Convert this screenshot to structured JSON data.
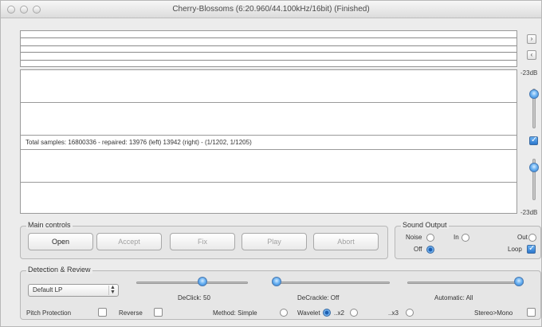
{
  "window": {
    "title": "Cherry-Blossoms (6:20.960/44.100kHz/16bit) (Finished)"
  },
  "side_buttons": {
    "forward": "›",
    "back": "‹"
  },
  "stats_text": "Total samples: 16800336 - repaired: 13976 (left) 13942 (right) - (1/1202, 1/1205)",
  "level": {
    "top_label": "-23dB",
    "bottom_label": "-23dB",
    "link_checked": true
  },
  "main_controls": {
    "title": "Main controls",
    "buttons": [
      "Open",
      "Accept",
      "Fix",
      "Play",
      "Abort"
    ],
    "enabled": [
      true,
      false,
      false,
      false,
      false
    ]
  },
  "sound_output": {
    "title": "Sound Output",
    "noise": "Noise",
    "in": "In",
    "out": "Out",
    "off": "Off",
    "loop": "Loop",
    "selected": "Off",
    "loop_checked": true
  },
  "detection": {
    "title": "Detection & Review",
    "preset": "Default LP",
    "declick_label": "DeClick: 50",
    "decrackle_label": "DeCrackle: Off",
    "automatic_label": "Automatic: All",
    "pitch_protection": "Pitch Protection",
    "reverse": "Reverse",
    "method_label": "Method: Simple",
    "wavelet": "Wavelet",
    "x2": "..x2",
    "x3": "..x3",
    "stereo_mono": "Stereo>Mono",
    "method_selected": "Wavelet",
    "declick_level": 0.6,
    "decrackle_level": 0.0,
    "automatic_level": 1.0
  }
}
